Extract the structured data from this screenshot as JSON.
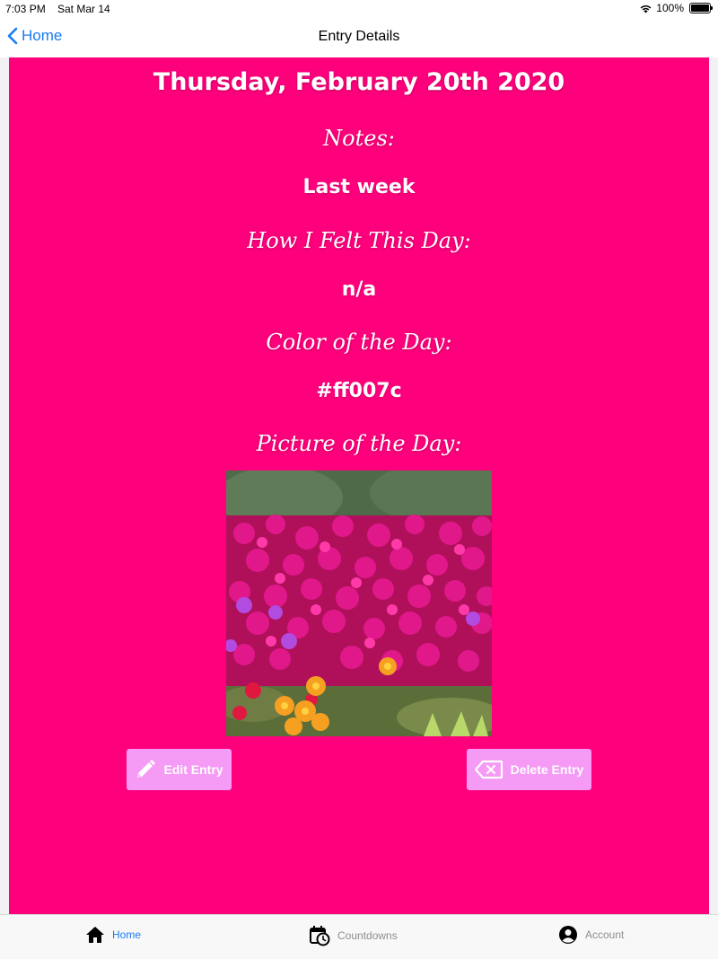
{
  "status": {
    "time": "7:03 PM",
    "date": "Sat Mar 14",
    "battery": "100%"
  },
  "nav": {
    "back_label": "Home",
    "title": "Entry Details"
  },
  "entry": {
    "date": "Thursday, February 20th 2020",
    "notes_label": "Notes:",
    "notes": "Last week",
    "feeling_label": "How I Felt This Day:",
    "feeling": "n/a",
    "color_label": "Color of the Day:",
    "color": "#ff007c",
    "picture_label": "Picture of the Day:"
  },
  "actions": {
    "edit_label": "Edit Entry",
    "delete_label": "Delete Entry"
  },
  "tabs": [
    {
      "label": "Home",
      "icon": "house-icon",
      "active": true
    },
    {
      "label": "Countdowns",
      "icon": "calendar-clock-icon",
      "active": false
    },
    {
      "label": "Account",
      "icon": "person-circle-icon",
      "active": false
    }
  ],
  "colors": {
    "background": "#ff007c",
    "button": "#f59af5",
    "accent": "#1a7cf3"
  }
}
